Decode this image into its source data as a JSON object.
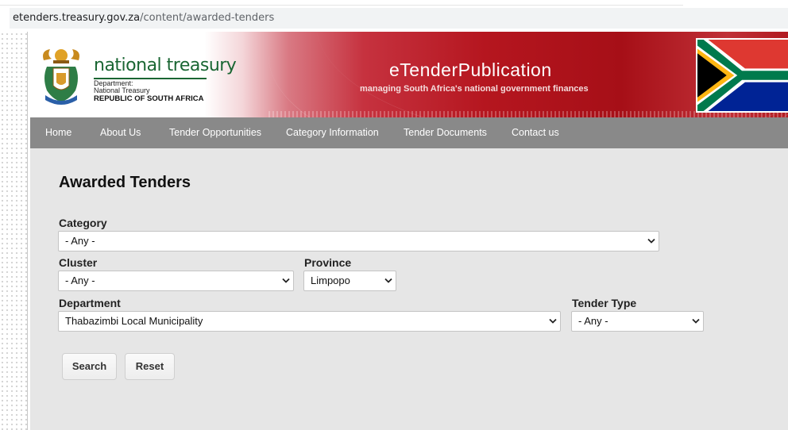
{
  "browser": {
    "url_host": "etenders.treasury.gov.za",
    "url_path": "/content/awarded-tenders"
  },
  "header": {
    "logo_name": "national treasury",
    "logo_dept_line1": "Department:",
    "logo_dept_line2": "National Treasury",
    "logo_country": "REPUBLIC OF SOUTH AFRICA",
    "site_title": "eTenderPublication",
    "site_tagline": "managing South Africa's national government finances",
    "icons": [
      "coat-of-arms-icon",
      "south-africa-flag-icon"
    ]
  },
  "nav": {
    "items": [
      "Home",
      "About Us",
      "Tender Opportunities",
      "Category Information",
      "Tender Documents",
      "Contact us"
    ]
  },
  "main": {
    "page_title": "Awarded Tenders",
    "filters": {
      "category": {
        "label": "Category",
        "value": "- Any -"
      },
      "cluster": {
        "label": "Cluster",
        "value": "- Any -"
      },
      "province": {
        "label": "Province",
        "value": "Limpopo"
      },
      "department": {
        "label": "Department",
        "value": "Thabazimbi Local Municipality"
      },
      "tender_type": {
        "label": "Tender Type",
        "value": "- Any -"
      }
    },
    "search_label": "Search",
    "reset_label": "Reset"
  },
  "colors": {
    "nav_bg": "#898989",
    "content_bg": "#e6e6e6",
    "banner_red": "#b5161f",
    "logo_green": "#1a6633"
  }
}
